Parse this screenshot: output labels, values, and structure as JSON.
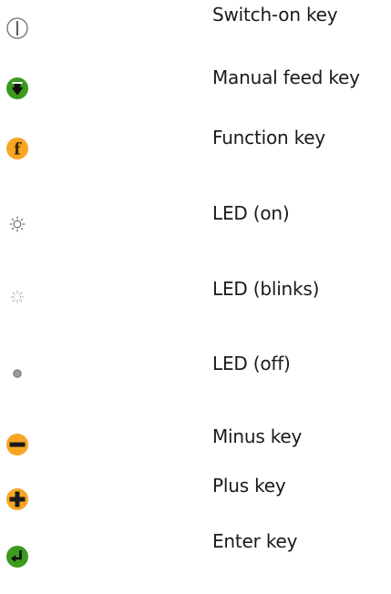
{
  "legend": {
    "items": [
      {
        "label": "Switch-on key",
        "icon": "switch-on-key-icon",
        "color": "#6e6e6e"
      },
      {
        "label": "Manual feed key",
        "icon": "manual-feed-key-icon",
        "color": "#3c9a1e"
      },
      {
        "label": "Function key",
        "icon": "function-key-icon",
        "color": "#f6a623"
      },
      {
        "label": "LED (on)",
        "icon": "led-on-icon",
        "color": "#555555"
      },
      {
        "label": "LED (blinks)",
        "icon": "led-blinks-icon",
        "color": "#777777"
      },
      {
        "label": "LED (off)",
        "icon": "led-off-icon",
        "color": "#8c8c8c"
      },
      {
        "label": "Minus key",
        "icon": "minus-key-icon",
        "color": "#f6a623"
      },
      {
        "label": "Plus key",
        "icon": "plus-key-icon",
        "color": "#f6a623"
      },
      {
        "label": "Enter key",
        "icon": "enter-key-icon",
        "color": "#3c9a1e"
      }
    ],
    "function_key_glyph": "f"
  }
}
